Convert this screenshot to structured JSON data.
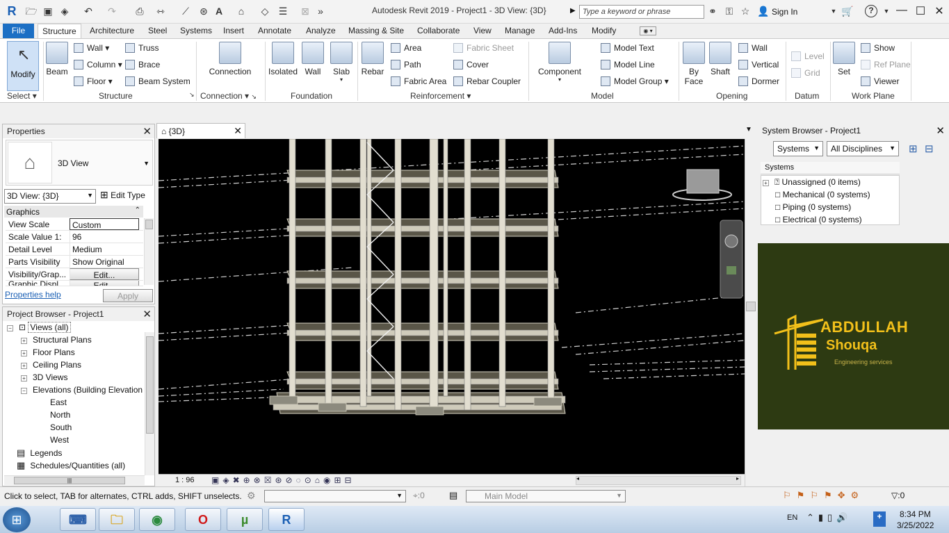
{
  "title_bar": {
    "title": "Autodesk Revit 2019 - Project1 - 3D View: {3D}",
    "search_placeholder": "Type a keyword or phrase",
    "sign_in": "Sign In"
  },
  "menu_tabs": [
    "File",
    "Structure",
    "Architecture",
    "Steel",
    "Systems",
    "Insert",
    "Annotate",
    "Analyze",
    "Massing & Site",
    "Collaborate",
    "View",
    "Manage",
    "Add-Ins",
    "Modify"
  ],
  "ribbon": {
    "modify": "Modify",
    "select": "Select",
    "beam": "Beam",
    "wall": "Wall",
    "column": "Column",
    "floor": "Floor",
    "truss": "Truss",
    "brace": "Brace",
    "beam_system": "Beam  System",
    "connection": "Connection",
    "isolated": "Isolated",
    "found_wall": "Wall",
    "slab": "Slab",
    "rebar": "Rebar",
    "area": "Area",
    "path": "Path",
    "fabric_area": "Fabric  Area",
    "fabric_sheet": "Fabric  Sheet",
    "cover": "Cover",
    "rebar_coupler": "Rebar  Coupler",
    "component": "Component",
    "model_text": "Model  Text",
    "model_line": "Model  Line",
    "model_group": "Model  Group",
    "by_face": "By\nFace",
    "shaft": "Shaft",
    "open_wall": "Wall",
    "vertical": "Vertical",
    "dormer": "Dormer",
    "level": "Level",
    "grid": "Grid",
    "set": "Set",
    "show": "Show",
    "ref_plane": "Ref  Plane",
    "viewer": "Viewer",
    "groups": {
      "select": "Select",
      "structure": "Structure",
      "connection": "Connection",
      "foundation": "Foundation",
      "reinforcement": "Reinforcement",
      "model": "Model",
      "opening": "Opening",
      "datum": "Datum",
      "work_plane": "Work Plane"
    }
  },
  "properties": {
    "title": "Properties",
    "type_name": "3D View",
    "view_selector": "3D View: {3D}",
    "edit_type": "Edit Type",
    "section": "Graphics",
    "rows": [
      {
        "key": "View Scale",
        "value": "Custom"
      },
      {
        "key": "Scale Value    1:",
        "value": "96"
      },
      {
        "key": "Detail Level",
        "value": "Medium"
      },
      {
        "key": "Parts Visibility",
        "value": "Show Original"
      },
      {
        "key": "Visibility/Grap...",
        "value": "Edit..."
      },
      {
        "key": "Graphic Displ...",
        "value": "Edit..."
      }
    ],
    "help_link": "Properties help",
    "apply": "Apply"
  },
  "project_browser": {
    "title": "Project Browser - Project1",
    "items": [
      {
        "label": "Views (all)"
      },
      {
        "label": "Structural Plans"
      },
      {
        "label": "Floor Plans"
      },
      {
        "label": "Ceiling Plans"
      },
      {
        "label": "3D Views"
      },
      {
        "label": "Elevations (Building Elevation"
      },
      {
        "label": "East"
      },
      {
        "label": "North"
      },
      {
        "label": "South"
      },
      {
        "label": "West"
      },
      {
        "label": "Legends"
      },
      {
        "label": "Schedules/Quantities (all)"
      }
    ]
  },
  "view": {
    "tab_label": "{3D}",
    "scale": "1 : 96"
  },
  "system_browser": {
    "title": "System Browser - Project1",
    "filter1": "Systems",
    "filter2": "All Disciplines",
    "column": "Systems",
    "items": [
      "Unassigned (0 items)",
      "Mechanical (0 systems)",
      "Piping (0 systems)",
      "Electrical (0 systems)"
    ]
  },
  "logo": {
    "name_line1": "ABDULLAH",
    "name_line2": "Shouqa",
    "tagline": "Engineering services"
  },
  "status": {
    "hint": "Click to select, TAB for alternates, CTRL adds, SHIFT unselects.",
    "sel_count": ":0",
    "model": "Main Model",
    "filter_count": ":0"
  },
  "taskbar": {
    "lang": "EN",
    "time": "8:34 PM",
    "date": "3/25/2022"
  },
  "colors": {
    "file_tab": "#1c6fc4",
    "viewport_bg": "#000000",
    "logo_bg": "#2d3a12",
    "logo_gold": "#f2c01a"
  }
}
